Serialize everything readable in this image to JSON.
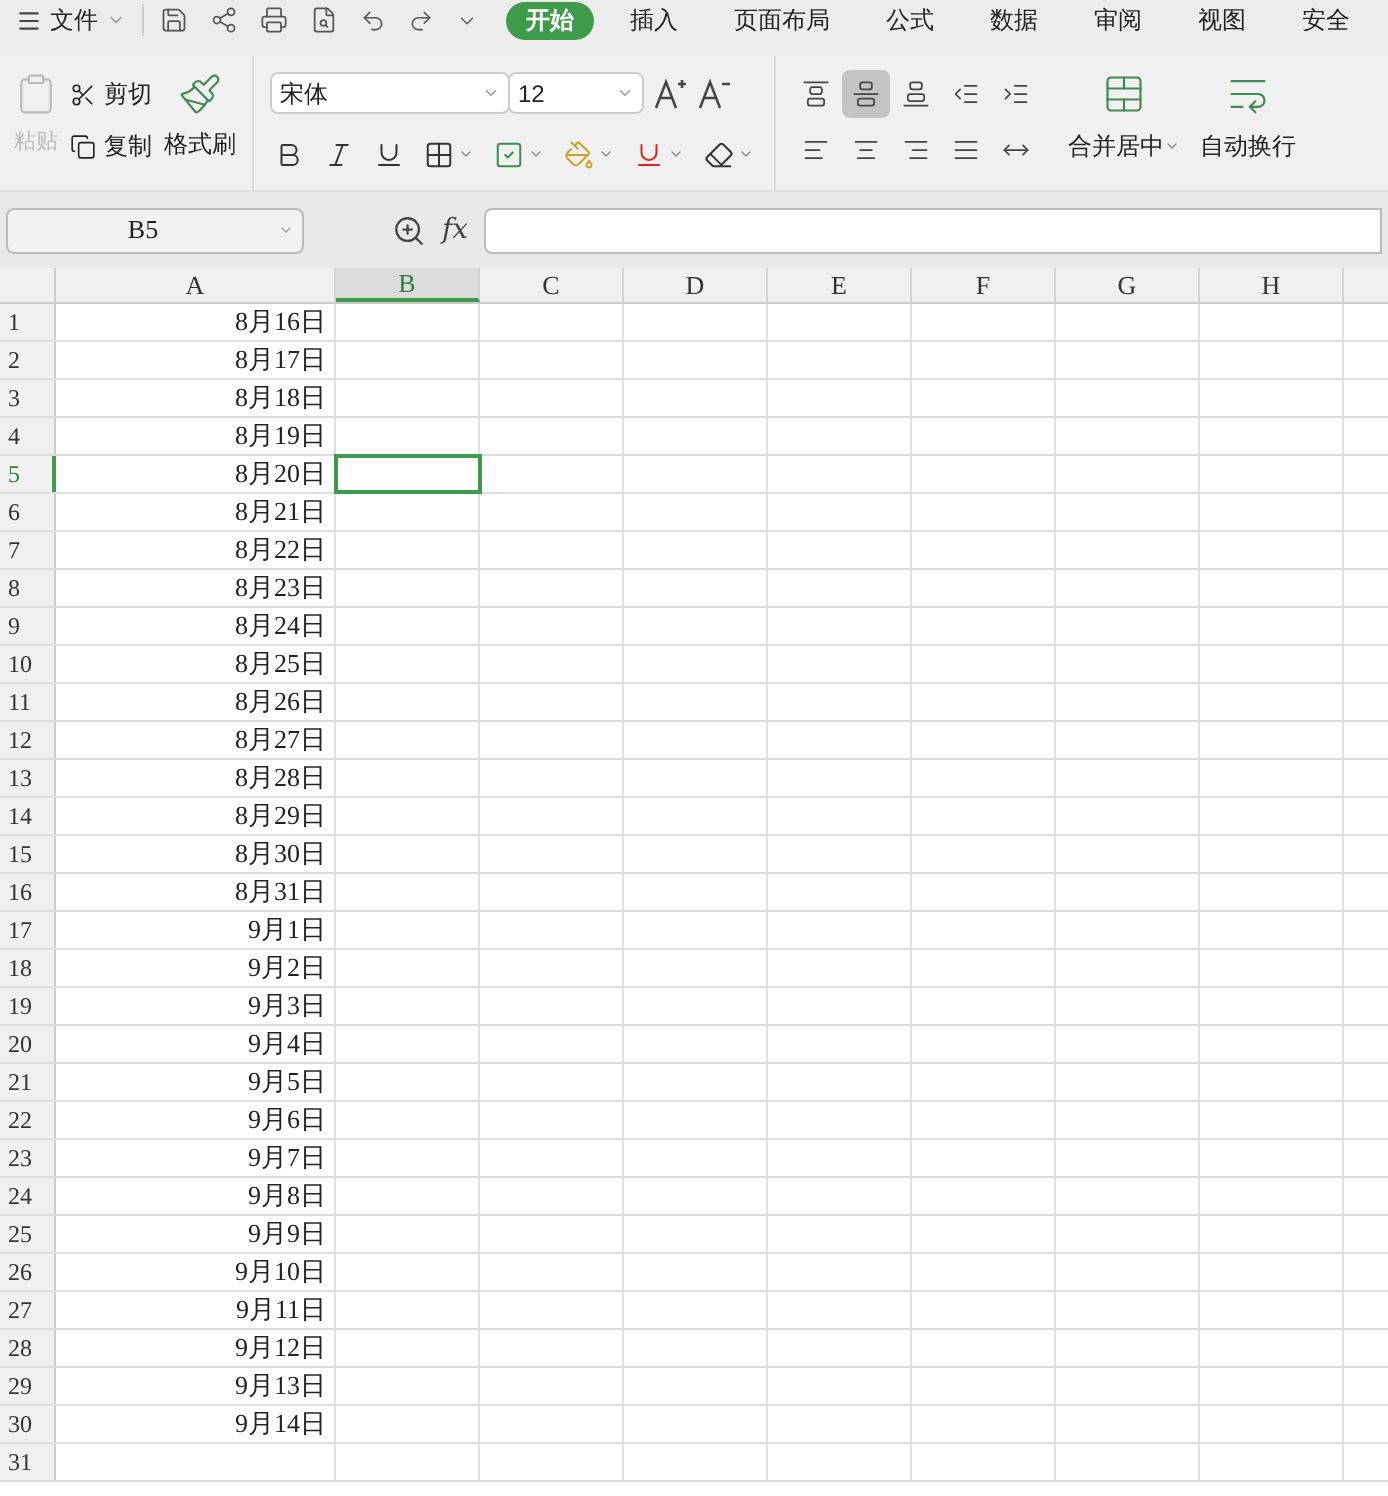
{
  "menu": {
    "file_label": "文件"
  },
  "tabs": [
    {
      "label": "开始",
      "selected": true
    },
    {
      "label": "插入",
      "selected": false
    },
    {
      "label": "页面布局",
      "selected": false
    },
    {
      "label": "公式",
      "selected": false
    },
    {
      "label": "数据",
      "selected": false
    },
    {
      "label": "审阅",
      "selected": false
    },
    {
      "label": "视图",
      "selected": false
    },
    {
      "label": "安全",
      "selected": false
    }
  ],
  "clipboard": {
    "paste": {
      "label": "粘贴",
      "disabled": true
    },
    "cut": "剪切",
    "copy": "复制",
    "format_painter": "格式刷"
  },
  "font": {
    "family": "宋体",
    "size": "12"
  },
  "align_top_row": [
    {
      "kind": "top",
      "selected": false
    },
    {
      "kind": "middle",
      "selected": true
    },
    {
      "kind": "bottom",
      "selected": false
    },
    {
      "kind": "outdent",
      "selected": false
    },
    {
      "kind": "indent",
      "selected": false
    }
  ],
  "align_bottom_row": [
    {
      "kind": "left",
      "selected": false
    },
    {
      "kind": "center",
      "selected": false
    },
    {
      "kind": "right",
      "selected": false
    },
    {
      "kind": "justify",
      "selected": false
    },
    {
      "kind": "distribute",
      "selected": false
    }
  ],
  "merge": {
    "label": "合并居中"
  },
  "wrap": {
    "label": "自动换行"
  },
  "name_box": "B5",
  "formula": {
    "label": "fx"
  },
  "columns": [
    {
      "label": "A",
      "selected": false
    },
    {
      "label": "B",
      "selected": true
    },
    {
      "label": "C",
      "selected": false
    },
    {
      "label": "D",
      "selected": false
    },
    {
      "label": "E",
      "selected": false
    },
    {
      "label": "F",
      "selected": false
    },
    {
      "label": "G",
      "selected": false
    },
    {
      "label": "H",
      "selected": false
    }
  ],
  "rows": [
    {
      "number": "1",
      "selected": false,
      "value": "8月16日"
    },
    {
      "number": "2",
      "selected": false,
      "value": "8月17日"
    },
    {
      "number": "3",
      "selected": false,
      "value": "8月18日"
    },
    {
      "number": "4",
      "selected": false,
      "value": "8月19日"
    },
    {
      "number": "5",
      "selected": true,
      "value": "8月20日"
    },
    {
      "number": "6",
      "selected": false,
      "value": "8月21日"
    },
    {
      "number": "7",
      "selected": false,
      "value": "8月22日"
    },
    {
      "number": "8",
      "selected": false,
      "value": "8月23日"
    },
    {
      "number": "9",
      "selected": false,
      "value": "8月24日"
    },
    {
      "number": "10",
      "selected": false,
      "value": "8月25日"
    },
    {
      "number": "11",
      "selected": false,
      "value": "8月26日"
    },
    {
      "number": "12",
      "selected": false,
      "value": "8月27日"
    },
    {
      "number": "13",
      "selected": false,
      "value": "8月28日"
    },
    {
      "number": "14",
      "selected": false,
      "value": "8月29日"
    },
    {
      "number": "15",
      "selected": false,
      "value": "8月30日"
    },
    {
      "number": "16",
      "selected": false,
      "value": "8月31日"
    },
    {
      "number": "17",
      "selected": false,
      "value": "9月1日"
    },
    {
      "number": "18",
      "selected": false,
      "value": "9月2日"
    },
    {
      "number": "19",
      "selected": false,
      "value": "9月3日"
    },
    {
      "number": "20",
      "selected": false,
      "value": "9月4日"
    },
    {
      "number": "21",
      "selected": false,
      "value": "9月5日"
    },
    {
      "number": "22",
      "selected": false,
      "value": "9月6日"
    },
    {
      "number": "23",
      "selected": false,
      "value": "9月7日"
    },
    {
      "number": "24",
      "selected": false,
      "value": "9月8日"
    },
    {
      "number": "25",
      "selected": false,
      "value": "9月9日"
    },
    {
      "number": "26",
      "selected": false,
      "value": "9月10日"
    },
    {
      "number": "27",
      "selected": false,
      "value": "9月11日"
    },
    {
      "number": "28",
      "selected": false,
      "value": "9月12日"
    },
    {
      "number": "29",
      "selected": false,
      "value": "9月13日"
    },
    {
      "number": "30",
      "selected": false,
      "value": "9月14日"
    },
    {
      "number": "31",
      "selected": false
    }
  ]
}
